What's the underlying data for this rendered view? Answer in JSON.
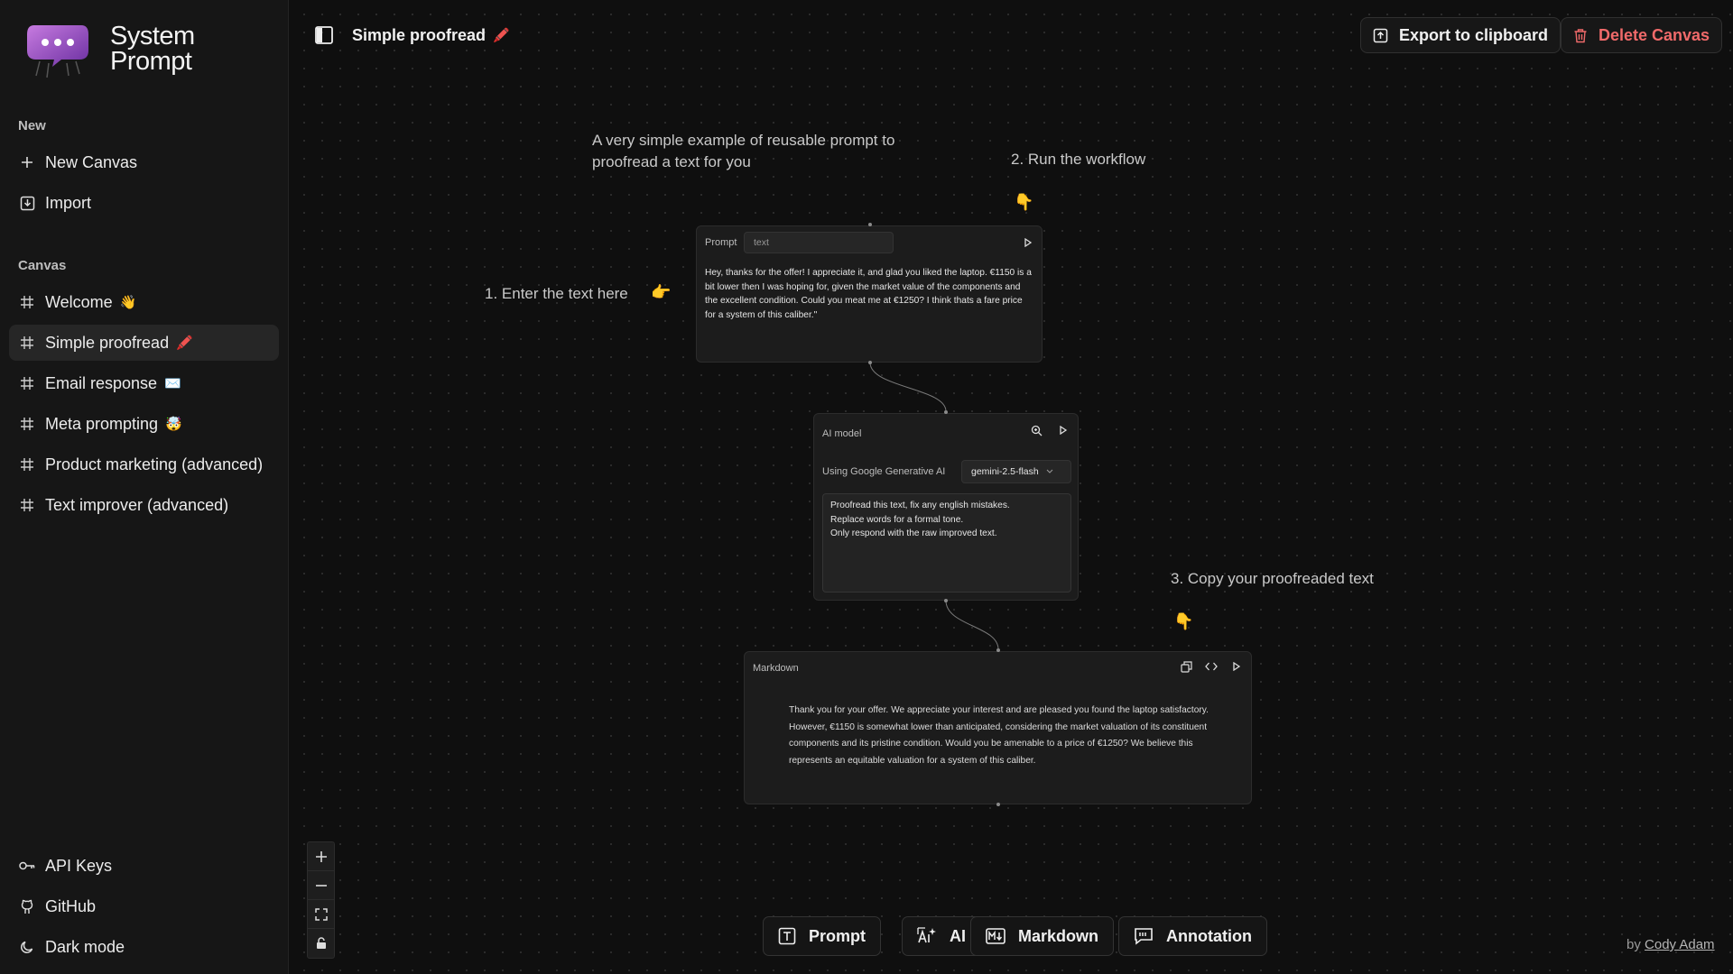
{
  "app": {
    "name_line1": "System",
    "name_line2": "Prompt"
  },
  "sidebar": {
    "new_label": "New",
    "new_items": [
      {
        "label": "New Canvas",
        "icon": "plus-icon"
      },
      {
        "label": "Import",
        "icon": "import-icon"
      }
    ],
    "canvas_label": "Canvas",
    "canvas_items": [
      {
        "label": "Welcome",
        "emoji": "👋",
        "active": false
      },
      {
        "label": "Simple proofread",
        "emoji": "🖍️",
        "active": true
      },
      {
        "label": "Email response",
        "emoji": "✉️",
        "active": false
      },
      {
        "label": "Meta prompting",
        "emoji": "🤯",
        "active": false
      },
      {
        "label": "Product marketing (advanced)",
        "emoji": "",
        "active": false
      },
      {
        "label": "Text improver (advanced)",
        "emoji": "",
        "active": false
      }
    ],
    "footer_items": [
      {
        "label": "API Keys",
        "icon": "key-icon"
      },
      {
        "label": "GitHub",
        "icon": "github-icon"
      },
      {
        "label": "Dark mode",
        "icon": "moon-icon"
      }
    ]
  },
  "header": {
    "title": "Simple proofread",
    "title_emoji": "🖍️",
    "export_label": "Export to clipboard",
    "delete_label": "Delete Canvas"
  },
  "annotations": {
    "intro": "A very simple example of reusable prompt to proofread a text for you",
    "step1": "1. Enter the text here",
    "step2": "2. Run the workflow",
    "step3": "3. Copy your proofreaded text",
    "hand_right": "👉",
    "hand_down": "👇"
  },
  "nodes": {
    "prompt": {
      "header": "Prompt",
      "variable_value": "text",
      "body": "Hey, thanks for the offer! I appreciate it, and glad you liked the laptop. €1150 is a bit lower then I was hoping for, given the market value of the components and the excellent condition. Could you meat me at €1250? I think thats a fare price for a system of this caliber.\""
    },
    "ai_model": {
      "header": "AI model",
      "provider_label": "Using Google Generative AI",
      "model_selected": "gemini-2.5-flash",
      "instructions": [
        "Proofread this text, fix any english mistakes.",
        "Replace words for a formal tone.",
        "Only respond with the raw improved text."
      ]
    },
    "markdown": {
      "header": "Markdown",
      "output": "Thank you for your offer. We appreciate your interest and are pleased you found the laptop satisfactory. However, €1150 is somewhat lower than anticipated, considering the market valuation of its constituent components and its pristine condition. Would you be amenable to a price of €1250? We believe this represents an equitable valuation for a system of this caliber."
    }
  },
  "toolbar": {
    "prompt_label": "Prompt",
    "ai_label": "AI",
    "markdown_label": "Markdown",
    "annotation_label": "Annotation"
  },
  "credit": {
    "prefix": "by",
    "author": "Cody Adam"
  },
  "colors": {
    "danger": "#f06a6a",
    "background": "#0f0f0f",
    "sidebar": "#161616"
  }
}
